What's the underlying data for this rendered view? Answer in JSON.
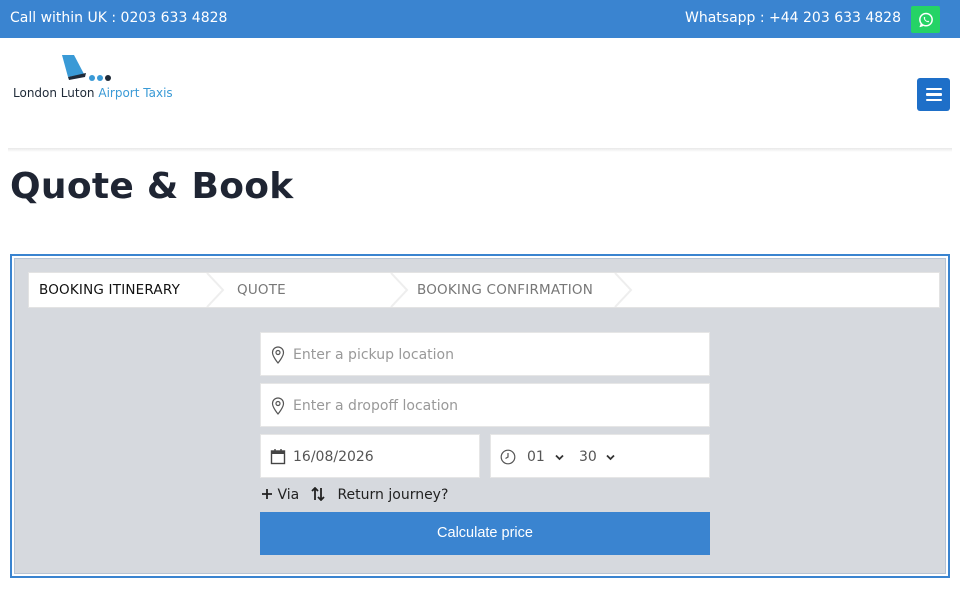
{
  "topbar": {
    "call_text": "Call within UK : 0203 633 4828",
    "whatsapp_text": "Whatsapp : +44 203 633 4828",
    "whatsapp_icon": "whatsapp-icon"
  },
  "header": {
    "logo_text_dark": "London Luton",
    "logo_text_blue": "Airport Taxis",
    "menu_icon": "hamburger-menu-icon"
  },
  "page": {
    "title": "Quote & Book"
  },
  "booking": {
    "steps": [
      {
        "label": "BOOKING ITINERARY",
        "active": true
      },
      {
        "label": "QUOTE",
        "active": false
      },
      {
        "label": "BOOKING CONFIRMATION",
        "active": false
      }
    ],
    "pickup": {
      "placeholder": "Enter a pickup location",
      "value": "",
      "icon": "map-pin-icon"
    },
    "dropoff": {
      "placeholder": "Enter a dropoff location",
      "value": "",
      "icon": "map-pin-icon"
    },
    "date": {
      "value": "16/08/2026",
      "icon": "calendar-icon"
    },
    "time": {
      "hour": "01",
      "minute": "30",
      "icon": "clock-icon"
    },
    "via_label": "Via",
    "return_label": "Return journey?",
    "calculate_label": "Calculate price"
  },
  "colors": {
    "brand_blue": "#3a84d0",
    "menu_blue": "#1e6fc8",
    "whatsapp_green": "#25d366",
    "form_bg": "#d6d9de"
  }
}
